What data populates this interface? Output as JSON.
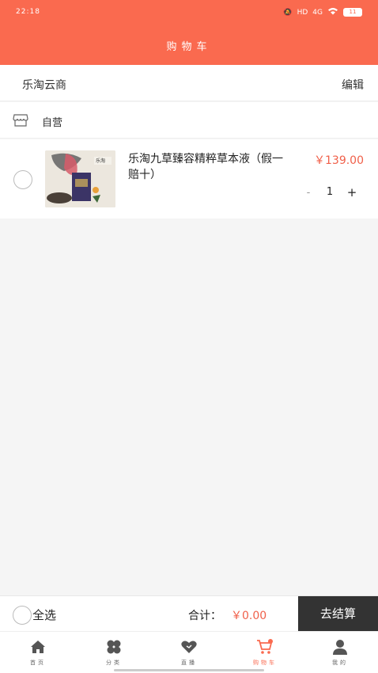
{
  "status_bar": {
    "time": "22:18",
    "signal": "4G",
    "hd": "HD",
    "battery": "11"
  },
  "header": {
    "title": "购物车"
  },
  "shop": {
    "name": "乐淘云商",
    "edit_label": "编辑"
  },
  "store": {
    "label": "自营",
    "icon": "store-icon"
  },
  "cart_items": [
    {
      "name": "乐淘九草臻容精粹草本液（假一赔十）",
      "price": "￥139.00",
      "quantity": "1",
      "minus_label": "-",
      "plus_label": "+",
      "selected": false
    }
  ],
  "checkout": {
    "select_all_label": "全选",
    "total_label": "合计：",
    "total_value": "￥0.00",
    "button_label": "去结算"
  },
  "tabbar": {
    "items": [
      {
        "label": "首页",
        "icon": "home-icon",
        "active": false
      },
      {
        "label": "分类",
        "icon": "category-icon",
        "active": false
      },
      {
        "label": "直播",
        "icon": "heart-icon",
        "active": false
      },
      {
        "label": "购物车",
        "icon": "cart-icon",
        "active": true
      },
      {
        "label": "我的",
        "icon": "user-icon",
        "active": false
      }
    ]
  },
  "colors": {
    "accent": "#fa6a4f",
    "price": "#f0604a",
    "checkout_button": "#333333"
  }
}
